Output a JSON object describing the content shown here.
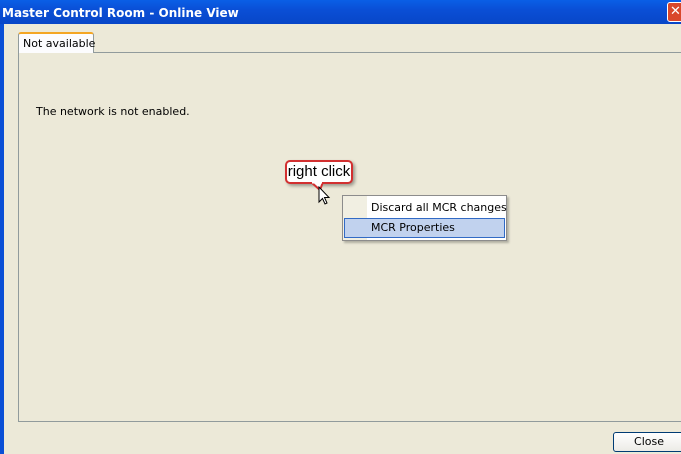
{
  "window": {
    "title": "Master Control Room - Online View",
    "close_glyph": "✕"
  },
  "tabs": [
    {
      "label": "Not available",
      "active": true
    }
  ],
  "main": {
    "message": "The network is not enabled."
  },
  "annotation": {
    "callout_text": "right click"
  },
  "context_menu": {
    "items": [
      {
        "label": "Discard all MCR changes",
        "highlighted": false
      },
      {
        "label": "MCR Properties",
        "highlighted": true
      }
    ]
  },
  "footer": {
    "close_label": "Close"
  },
  "colors": {
    "titlebar": "#0a4fd6",
    "tab_accent": "#f4a623",
    "highlight": "#c1d2ee",
    "callout_border": "#d23030"
  }
}
